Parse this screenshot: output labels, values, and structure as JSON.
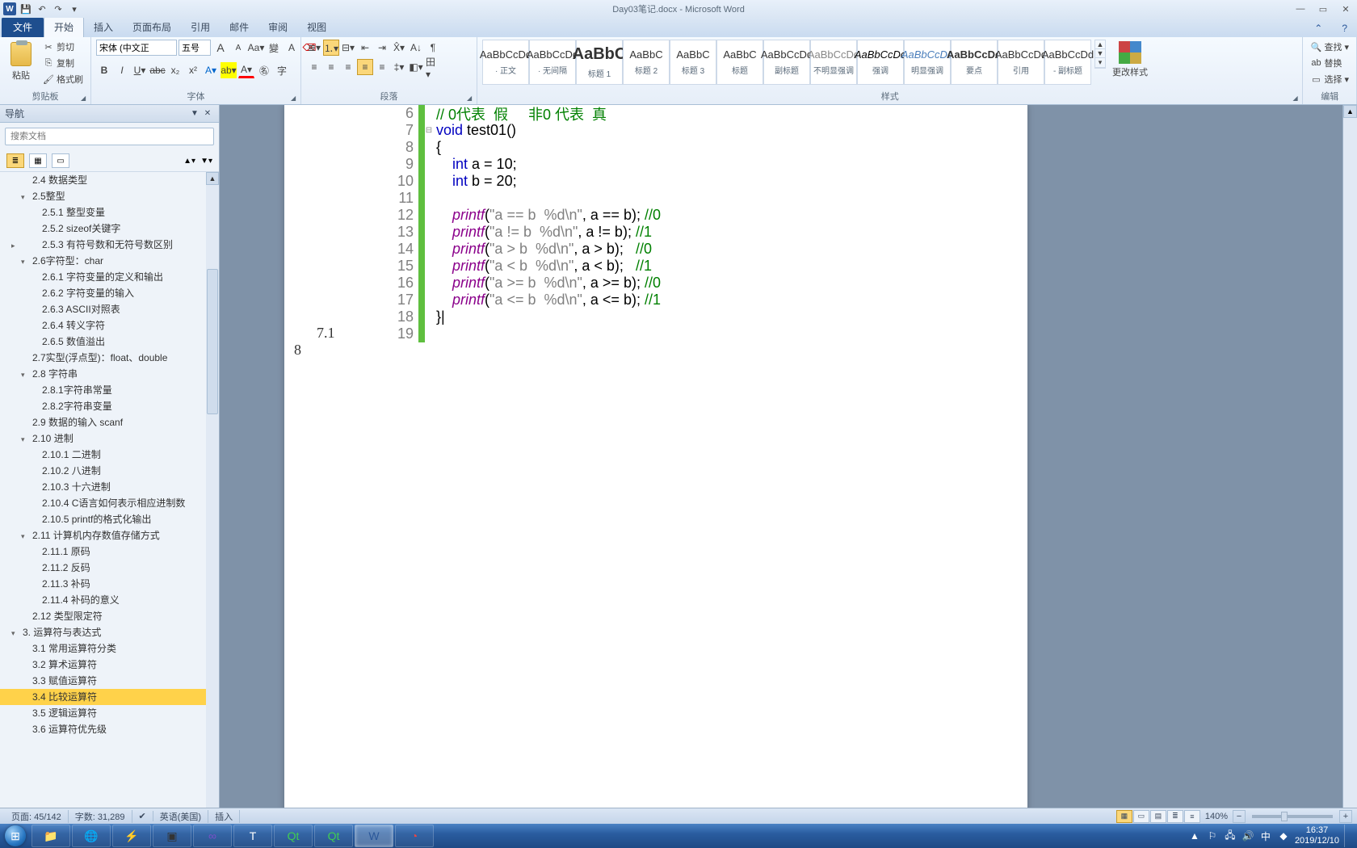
{
  "window": {
    "title": "Day03笔记.docx - Microsoft Word"
  },
  "qat": {
    "save": "💾",
    "undo": "↶",
    "redo": "↷"
  },
  "tabs": {
    "file": "文件",
    "home": "开始",
    "insert": "插入",
    "layout": "页面布局",
    "ref": "引用",
    "mail": "邮件",
    "review": "审阅",
    "view": "视图"
  },
  "clipboard": {
    "paste": "粘贴",
    "cut": "剪切",
    "copy": "复制",
    "fmt": "格式刷",
    "group": "剪贴板"
  },
  "font": {
    "name": "宋体 (中文正",
    "size": "五号",
    "bold": "B",
    "italic": "I",
    "underline": "U",
    "strike": "abc",
    "sub": "x₂",
    "sup": "x²",
    "grow": "A",
    "shrink": "A",
    "clear": "Aa",
    "case": "Aa",
    "phonetic": "拼",
    "border": "田",
    "highlight": "ab",
    "color": "A",
    "circle": "㊕",
    "charfmt": "字",
    "group": "字体"
  },
  "para": {
    "bullets": "•",
    "numbers": "1.",
    "multilevel": "≡",
    "indentL": "⇤",
    "indentR": "⇥",
    "sort": "A↓",
    "asian": "X",
    "show": "¶",
    "sortZ": "↓A",
    "alignL": "≡",
    "alignC": "≡",
    "alignR": "≡",
    "alignJ": "≡",
    "spacing": "↕",
    "shading": "◧",
    "borders": "田",
    "group": "段落"
  },
  "styles": {
    "list": [
      {
        "preview": "AaBbCcDd",
        "name": "· 正文"
      },
      {
        "preview": "AaBbCcDd",
        "name": "· 无间隔"
      },
      {
        "preview": "AaBbC",
        "name": "标题 1",
        "big": true
      },
      {
        "preview": "AaBbC",
        "name": "标题 2"
      },
      {
        "preview": "AaBbC",
        "name": "标题 3"
      },
      {
        "preview": "AaBbC",
        "name": "标题"
      },
      {
        "preview": "AaBbCcDd",
        "name": "副标题"
      },
      {
        "preview": "AaBbCcDd",
        "name": "不明显强调",
        "color": "#888"
      },
      {
        "preview": "AaBbCcDd",
        "name": "强调",
        "color": "#000",
        "italic": true
      },
      {
        "preview": "AaBbCcDd",
        "name": "明显强调",
        "color": "#4a7ebb",
        "italic": true
      },
      {
        "preview": "AaBbCcDd",
        "name": "要点",
        "bold": true
      },
      {
        "preview": "AaBbCcDd",
        "name": "引用"
      },
      {
        "preview": "AaBbCcDd",
        "name": "- 副标题"
      }
    ],
    "change": "更改样式",
    "group": "样式"
  },
  "editing": {
    "find": "查找",
    "replace": "替换",
    "select": "选择",
    "group": "编辑"
  },
  "navpane": {
    "title": "导航",
    "search_placeholder": "搜索文档",
    "items": [
      {
        "lvl": 2,
        "text": "2.4 数据类型"
      },
      {
        "lvl": 2,
        "text": "2.5整型",
        "tw": "▾"
      },
      {
        "lvl": 3,
        "text": "2.5.1 整型变量"
      },
      {
        "lvl": 3,
        "text": "2.5.2 sizeof关键字"
      },
      {
        "lvl": 3,
        "text": "2.5.3 有符号数和无符号数区别",
        "tw": "▸"
      },
      {
        "lvl": 2,
        "text": "2.6字符型：char",
        "tw": "▾"
      },
      {
        "lvl": 3,
        "text": "2.6.1 字符变量的定义和输出"
      },
      {
        "lvl": 3,
        "text": "2.6.2 字符变量的输入"
      },
      {
        "lvl": 3,
        "text": "2.6.3 ASCII对照表"
      },
      {
        "lvl": 3,
        "text": "2.6.4 转义字符"
      },
      {
        "lvl": 3,
        "text": "2.6.5 数值溢出"
      },
      {
        "lvl": 2,
        "text": "2.7实型(浮点型)：float、double"
      },
      {
        "lvl": 2,
        "text": "2.8 字符串",
        "tw": "▾"
      },
      {
        "lvl": 3,
        "text": "2.8.1字符串常量"
      },
      {
        "lvl": 3,
        "text": "2.8.2字符串变量"
      },
      {
        "lvl": 2,
        "text": "2.9 数据的输入 scanf"
      },
      {
        "lvl": 2,
        "text": "2.10 进制",
        "tw": "▾"
      },
      {
        "lvl": 3,
        "text": "2.10.1 二进制"
      },
      {
        "lvl": 3,
        "text": "2.10.2 八进制"
      },
      {
        "lvl": 3,
        "text": "2.10.3 十六进制"
      },
      {
        "lvl": 3,
        "text": "2.10.4 C语言如何表示相应进制数"
      },
      {
        "lvl": 3,
        "text": "2.10.5 printf的格式化输出"
      },
      {
        "lvl": 2,
        "text": "2.11 计算机内存数值存储方式",
        "tw": "▾"
      },
      {
        "lvl": 3,
        "text": "2.11.1 原码"
      },
      {
        "lvl": 3,
        "text": "2.11.2 反码"
      },
      {
        "lvl": 3,
        "text": "2.11.3 补码"
      },
      {
        "lvl": 3,
        "text": "2.11.4 补码的意义"
      },
      {
        "lvl": 2,
        "text": "2.12 类型限定符"
      },
      {
        "lvl": 1,
        "text": "3. 运算符与表达式",
        "tw": "▾"
      },
      {
        "lvl": 2,
        "text": "3.1 常用运算符分类"
      },
      {
        "lvl": 2,
        "text": "3.2 算术运算符"
      },
      {
        "lvl": 2,
        "text": "3.3 赋值运算符"
      },
      {
        "lvl": 2,
        "text": "3.4 比较运算符",
        "sel": true
      },
      {
        "lvl": 2,
        "text": "3.5 逻辑运算符"
      },
      {
        "lvl": 2,
        "text": "3.6 运算符优先级"
      }
    ]
  },
  "doc": {
    "margins": {
      "m1": "7.1",
      "m2": "8"
    },
    "code": [
      {
        "n": "6",
        "fold": "",
        "html": "<span class='cm'>// 0代表  假     非0 代表  真</span>"
      },
      {
        "n": "7",
        "fold": "⊟",
        "html": "<span class='kw'>void</span> test01()"
      },
      {
        "n": "8",
        "fold": "",
        "html": "{"
      },
      {
        "n": "9",
        "fold": "",
        "html": "    <span class='kw'>int</span> a = 10;"
      },
      {
        "n": "10",
        "fold": "",
        "html": "    <span class='kw'>int</span> b = 20;"
      },
      {
        "n": "11",
        "fold": "",
        "html": ""
      },
      {
        "n": "12",
        "fold": "",
        "html": "    <span class='fn'>printf</span>(<span class='str'>\"a == b  %d\\n\"</span>, a == b); <span class='cm'>//0</span>"
      },
      {
        "n": "13",
        "fold": "",
        "html": "    <span class='fn'>printf</span>(<span class='str'>\"a != b  %d\\n\"</span>, a != b); <span class='cm'>//1</span>"
      },
      {
        "n": "14",
        "fold": "",
        "html": "    <span class='fn'>printf</span>(<span class='str'>\"a > b  %d\\n\"</span>, a > b);   <span class='cm'>//0</span>"
      },
      {
        "n": "15",
        "fold": "",
        "html": "    <span class='fn'>printf</span>(<span class='str'>\"a < b  %d\\n\"</span>, a < b);   <span class='cm'>//1</span>"
      },
      {
        "n": "16",
        "fold": "",
        "html": "    <span class='fn'>printf</span>(<span class='str'>\"a >= b  %d\\n\"</span>, a >= b); <span class='cm'>//0</span>"
      },
      {
        "n": "17",
        "fold": "",
        "html": "    <span class='fn'>printf</span>(<span class='str'>\"a <= b  %d\\n\"</span>, a <= b); <span class='cm'>//1</span>"
      },
      {
        "n": "18",
        "fold": "",
        "html": "}|"
      },
      {
        "n": "19",
        "fold": "",
        "html": ""
      }
    ]
  },
  "status": {
    "page": "页面: 45/142",
    "words": "字数: 31,289",
    "lang": "英语(美国)",
    "mode": "插入",
    "zoom": "140%"
  },
  "taskbar": {
    "apps": [
      {
        "icon": "📁",
        "name": "explorer"
      },
      {
        "icon": "🌐",
        "name": "chrome",
        "color": "#f4c20d"
      },
      {
        "icon": "⚡",
        "name": "thunder",
        "color": "#1e90ff"
      },
      {
        "icon": "▣",
        "name": "sublime",
        "color": "#333"
      },
      {
        "icon": "∞",
        "name": "vs",
        "color": "#7b4fc9"
      },
      {
        "icon": "T",
        "name": "txt"
      },
      {
        "icon": "Qt",
        "name": "qt1",
        "color": "#41cd52"
      },
      {
        "icon": "Qt",
        "name": "qt2",
        "color": "#41cd52"
      },
      {
        "icon": "W",
        "name": "word",
        "active": true,
        "color": "#2a579a"
      },
      {
        "icon": "◔",
        "name": "app9",
        "color": "#e44"
      }
    ],
    "clock_time": "16:37",
    "clock_date": "2019/12/10"
  }
}
